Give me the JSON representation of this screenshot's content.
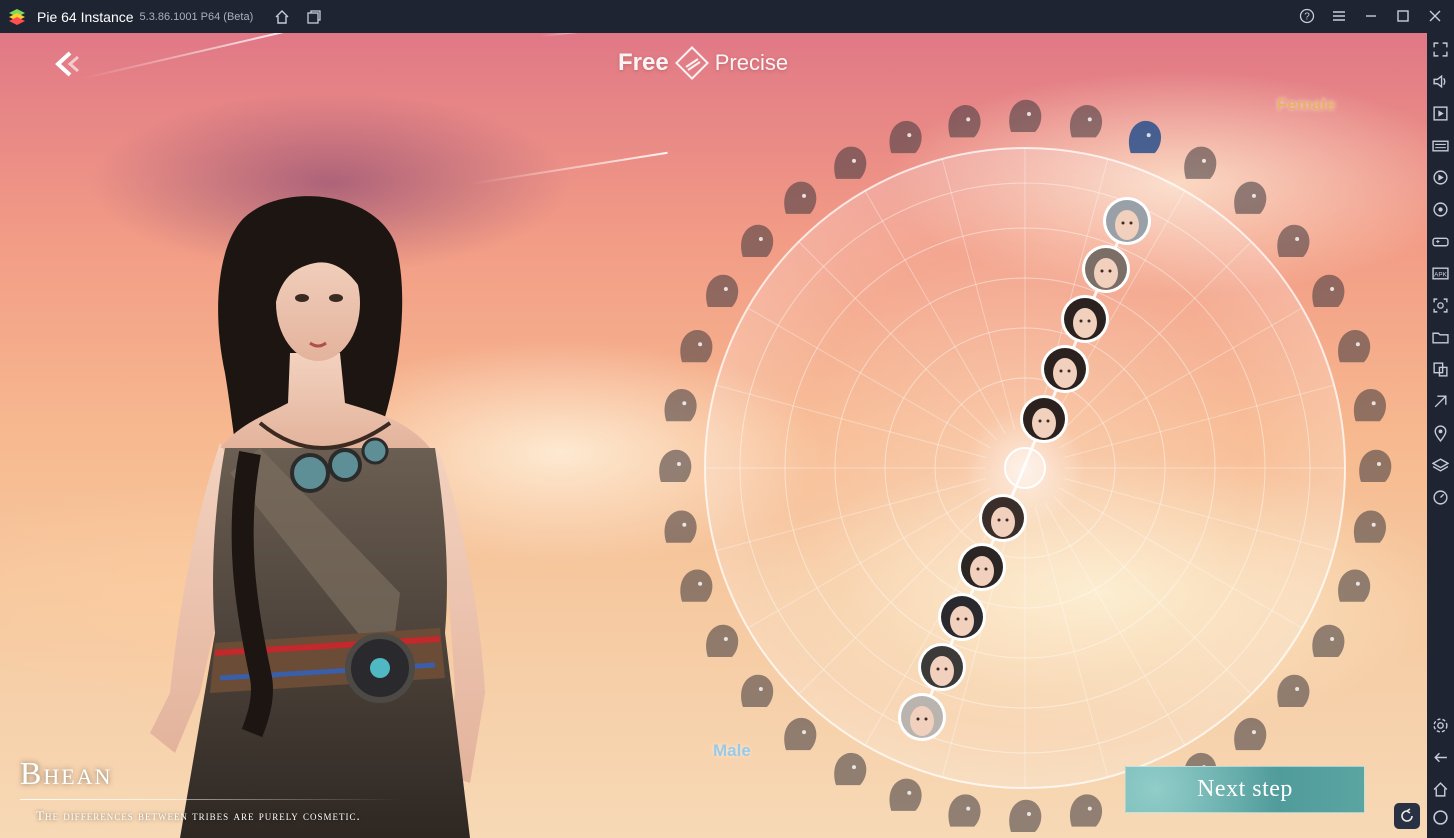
{
  "window": {
    "title": "Pie 64 Instance",
    "version": "5.3.86.1001 P64 (Beta)",
    "controls": [
      "home-icon",
      "multi-instance-icon",
      "help-icon",
      "menu-icon",
      "minimize-icon",
      "maximize-icon",
      "close-icon"
    ]
  },
  "game": {
    "mode_toggle": {
      "left": "Free",
      "right": "Precise"
    },
    "race": {
      "name": "Bhean",
      "description": "The differences between tribes are purely cosmetic."
    },
    "gender_labels": {
      "female": "Female",
      "male": "Male"
    },
    "next_step": "Next step",
    "faces_selected_index": 4
  },
  "sidebar": {
    "icons": [
      "fullscreen-icon",
      "volume-icon",
      "media-icon",
      "keyboard-icon",
      "record-icon",
      "rotate-icon",
      "gamepad-icon",
      "apk-icon",
      "screenshot-icon",
      "folder-icon",
      "multi-window-icon",
      "eco-mode-icon",
      "location-icon",
      "layers-icon",
      "speed-icon",
      "settings-icon",
      "back-icon",
      "home-icon"
    ]
  },
  "colors": {
    "titlebar": "#1f2433",
    "female_accent": "#e9b06a",
    "male_accent": "#9cc9e6",
    "button_teal": "#4f9b9a"
  }
}
